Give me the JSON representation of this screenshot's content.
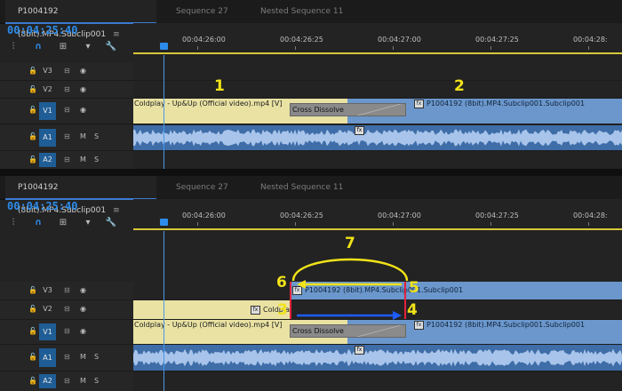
{
  "tabs": [
    {
      "label": "P1004192 (8bit).MP4.Subclip001",
      "close": "≡"
    },
    {
      "label": "Sequence 27"
    },
    {
      "label": "Nested Sequence 11"
    }
  ],
  "timecode": "00:04:25:40",
  "ruler": [
    "00:04:26:00",
    "00:04:26:25",
    "00:04:27:00",
    "00:04:27:25",
    "00:04:28:"
  ],
  "tracks": {
    "v3": "V3",
    "v2": "V2",
    "v1": "V1",
    "a1": "A1",
    "a2": "A2",
    "m": "M",
    "s": "S"
  },
  "clips": {
    "coldplay": "Coldplay - Up&Up (Official video).mp4 [V]",
    "coldplay_v2": "Coldplay - Up&Up (Official video).mp4 [V]",
    "dissolve": "Cross Dissolve",
    "subclip": "P1004192 (8bit).MP4.Subclip001.Subclip001",
    "subclip_v3": "P1004192 (8bit).MP4.Subclip001.Subclip001",
    "fx": "fx"
  },
  "annotations": {
    "n1": "1",
    "n2": "2",
    "n3": "3",
    "n4": "4",
    "n5": "5",
    "n6": "6",
    "n7": "7"
  },
  "colors": {
    "accent": "#2d8ceb",
    "video_clip_a": "#e9e2a3",
    "video_clip_b": "#6b97cc",
    "audio_clip": "#3e6da8",
    "annotation_yellow": "#f1e318",
    "annotation_arrow_blue": "#1e5cff",
    "trim_red": "#e2223c"
  },
  "icons": [
    "wrench-icon",
    "marker-icon",
    "snap-icon",
    "nest-icon",
    "lock-icon",
    "eye-icon",
    "track-output-icon"
  ]
}
